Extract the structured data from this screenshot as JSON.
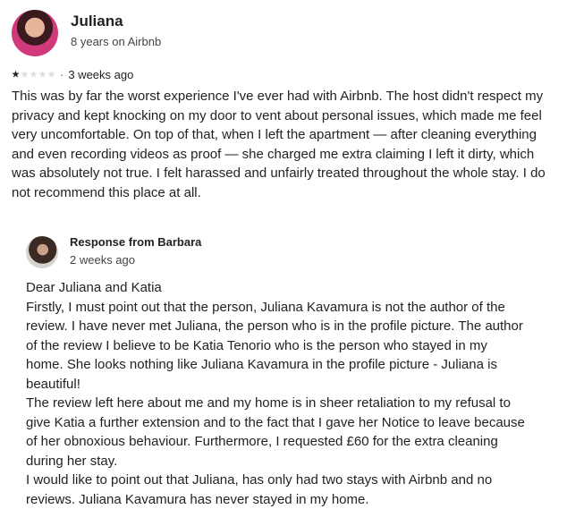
{
  "review": {
    "reviewer_name": "Juliana",
    "reviewer_tenure": "8 years on Airbnb",
    "rating": 1,
    "rating_max": 5,
    "separator": "·",
    "date": "3 weeks ago",
    "text": "This was by far the worst experience I've ever had with Airbnb. The host didn't respect my privacy and kept knocking on my door to vent about personal issues, which made me feel very uncomfortable. On top of that, when I left the apartment — after cleaning everything and even recording videos as proof — she charged me extra claiming I left it dirty, which was absolutely not true. I felt harassed and unfairly treated throughout the whole stay. I do not recommend this place at all."
  },
  "response": {
    "title": "Response from Barbara",
    "date": "2 weeks ago",
    "paragraphs": [
      "Dear Juliana and Katia",
      "Firstly, I must point out that the person, Juliana Kavamura is not the author of the review. I have never met Juliana, the person who is in the profile picture. The author of the review I believe to be Katia Tenorio who is the person who stayed in my home. She looks nothing like Juliana Kavamura in the profile picture - Juliana is beautiful!",
      "The review left here about me and my home is in sheer retaliation to my refusal to give Katia a further extension and to the fact that I gave her Notice to leave because of her obnoxious behaviour. Furthermore, I requested £60 for the extra cleaning during her stay.",
      "I would like to point out that Juliana, has only had two stays with Airbnb and no reviews. Juliana Kavamura has never stayed in my home."
    ]
  }
}
